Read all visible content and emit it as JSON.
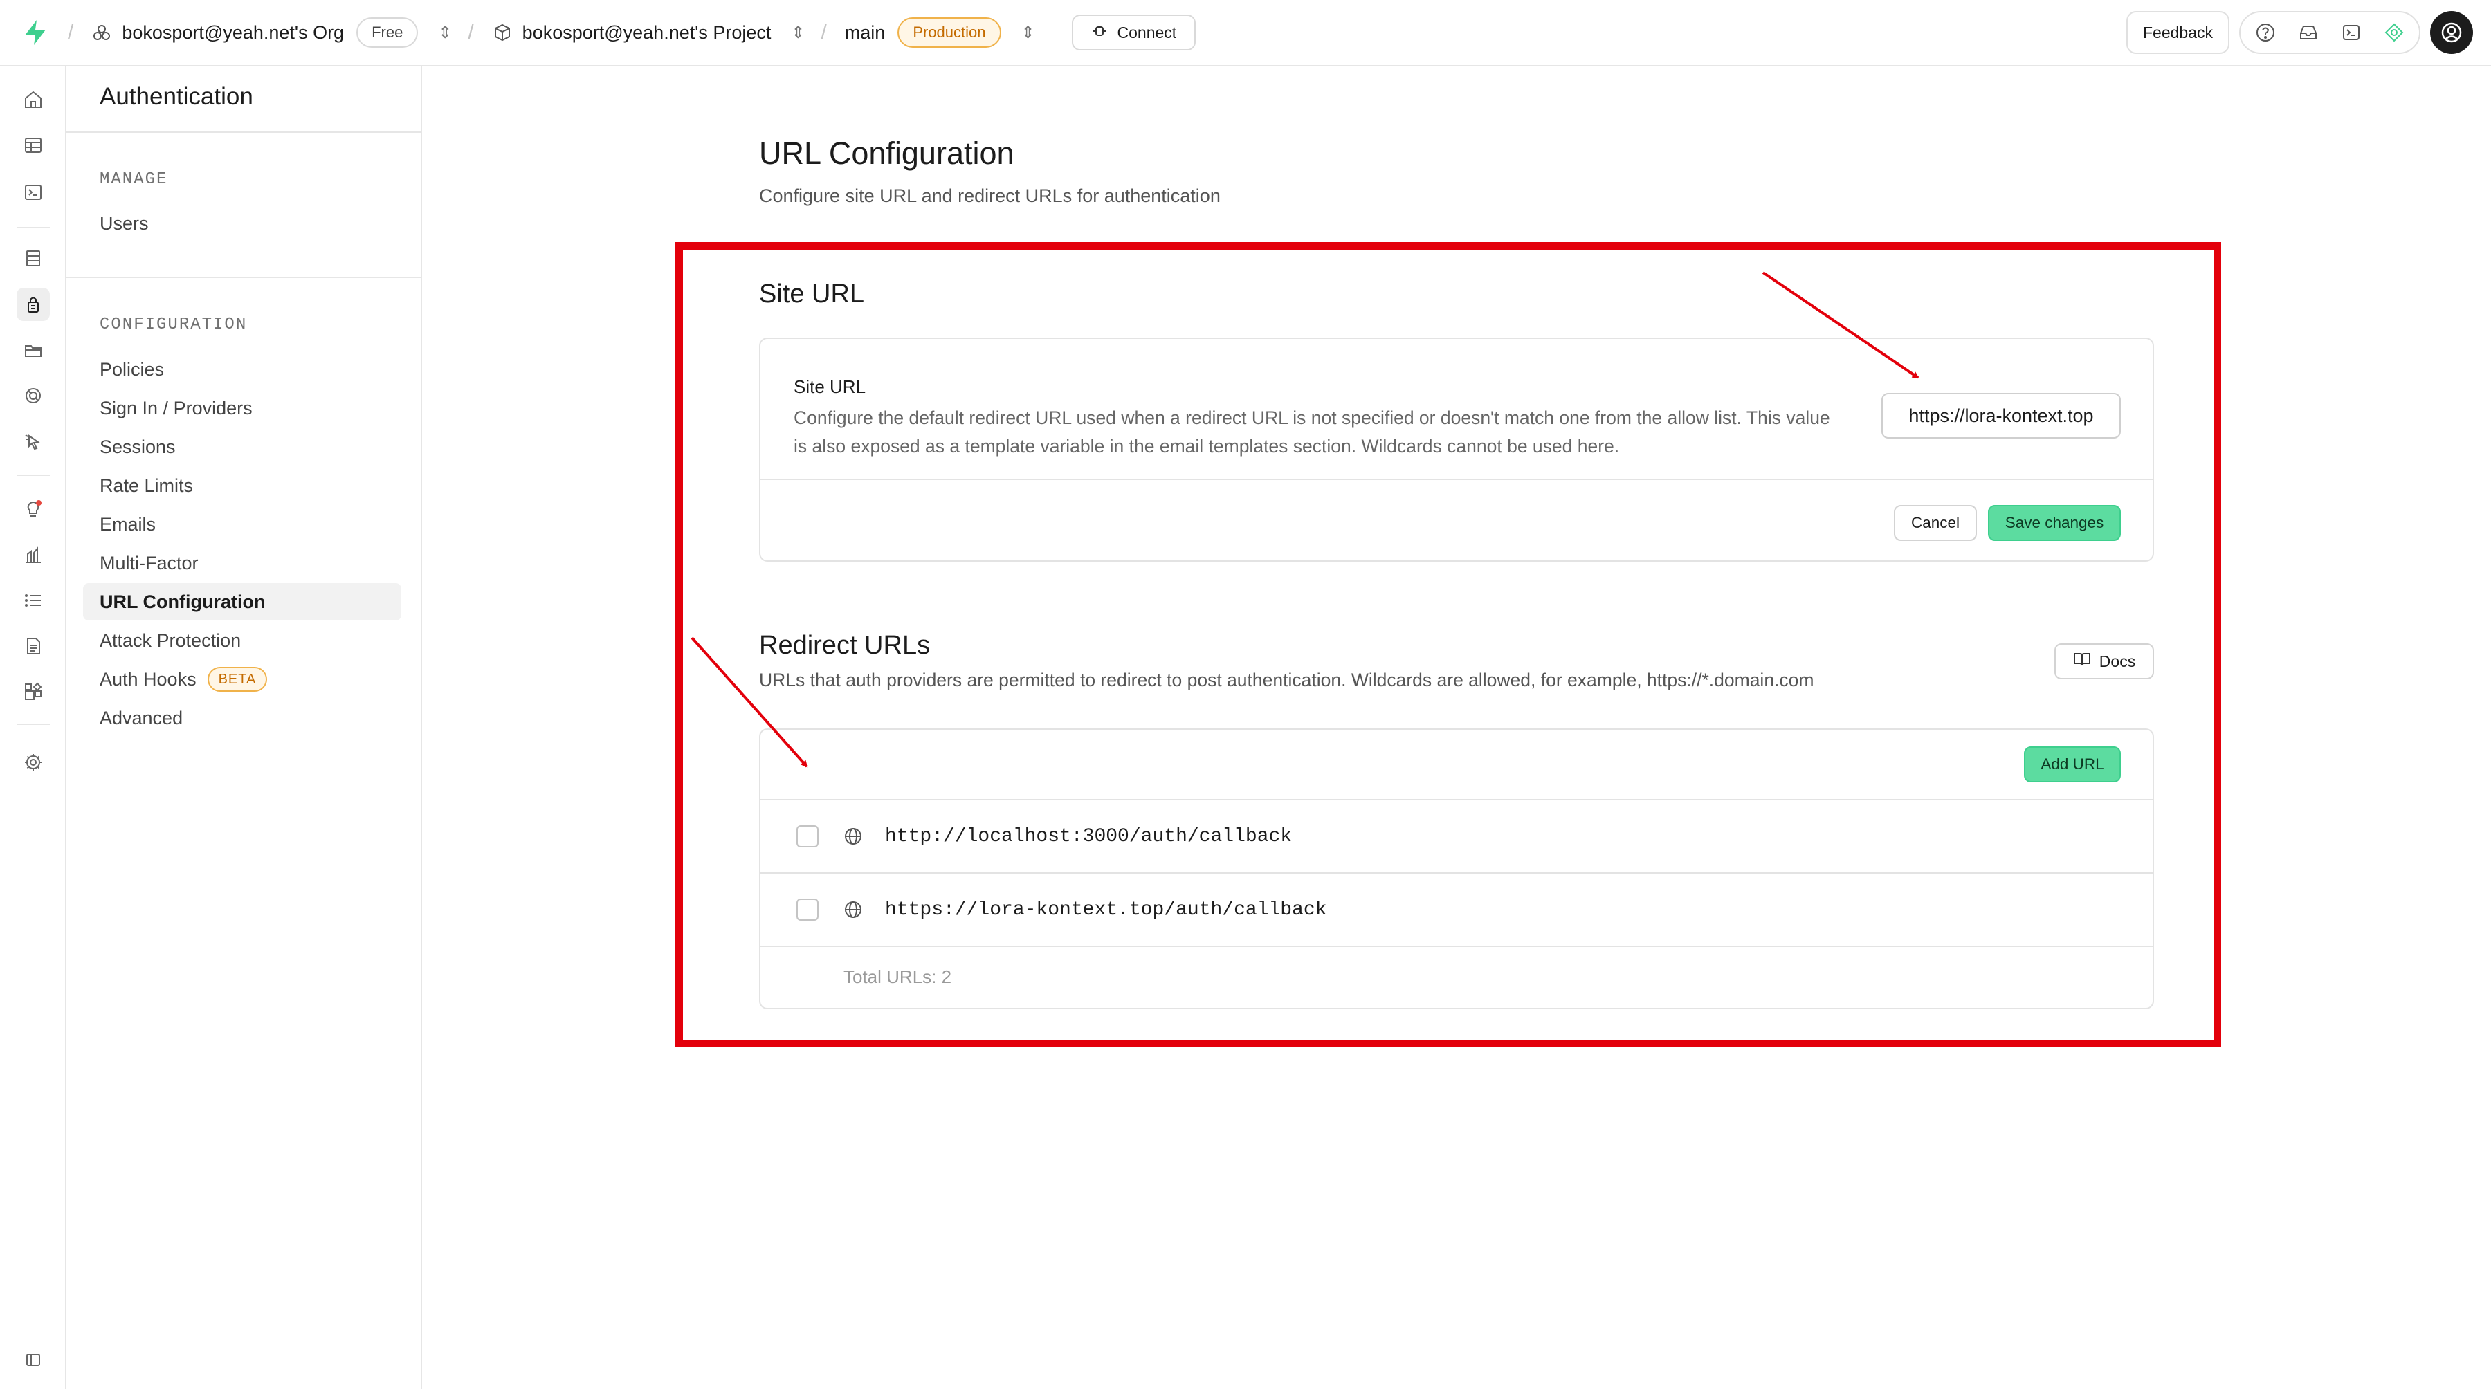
{
  "topbar": {
    "org_name": "bokosport@yeah.net's Org",
    "org_plan": "Free",
    "project_name": "bokosport@yeah.net's Project",
    "branch": "main",
    "environment": "Production",
    "connect_label": "Connect",
    "feedback_label": "Feedback",
    "icons": [
      "help-icon",
      "inbox-icon",
      "terminal-icon",
      "advisor-icon"
    ]
  },
  "rail": {
    "icons": [
      "home-icon",
      "table-editor-icon",
      "sql-editor-icon",
      "database-icon",
      "authentication-icon",
      "storage-icon",
      "edge-functions-icon",
      "realtime-icon",
      "advisors-icon",
      "reports-icon",
      "logs-icon",
      "api-docs-icon",
      "integrations-icon",
      "settings-icon",
      "collapse-sidebar-icon"
    ],
    "active": "authentication-icon"
  },
  "sidebar": {
    "title": "Authentication",
    "manage_heading": "MANAGE",
    "manage_items": [
      "Users"
    ],
    "config_heading": "CONFIGURATION",
    "config_items": [
      "Policies",
      "Sign In / Providers",
      "Sessions",
      "Rate Limits",
      "Emails",
      "Multi-Factor",
      "URL Configuration",
      "Attack Protection",
      "Auth Hooks",
      "Advanced"
    ],
    "active_item": "URL Configuration",
    "auth_hooks_badge": "BETA"
  },
  "main": {
    "title": "URL Configuration",
    "subtitle": "Configure site URL and redirect URLs for authentication",
    "site_url": {
      "section_title": "Site URL",
      "field_label": "Site URL",
      "description": "Configure the default redirect URL used when a redirect URL is not specified or doesn't match one from the allow list. This value is also exposed as a template variable in the email templates section. Wildcards cannot be used here.",
      "value": "https://lora-kontext.top",
      "cancel_label": "Cancel",
      "save_label": "Save changes"
    },
    "redirect_urls": {
      "section_title": "Redirect URLs",
      "description": "URLs that auth providers are permitted to redirect to post authentication. Wildcards are allowed, for example, https://*.domain.com",
      "docs_label": "Docs",
      "add_label": "Add URL",
      "urls": [
        "http://localhost:3000/auth/callback",
        "https://lora-kontext.top/auth/callback"
      ],
      "total_label": "Total URLs: 2"
    }
  },
  "colors": {
    "brand_green": "#3ecf8e",
    "annotation_red": "#e3000b",
    "production_orange": "#c46b00"
  }
}
